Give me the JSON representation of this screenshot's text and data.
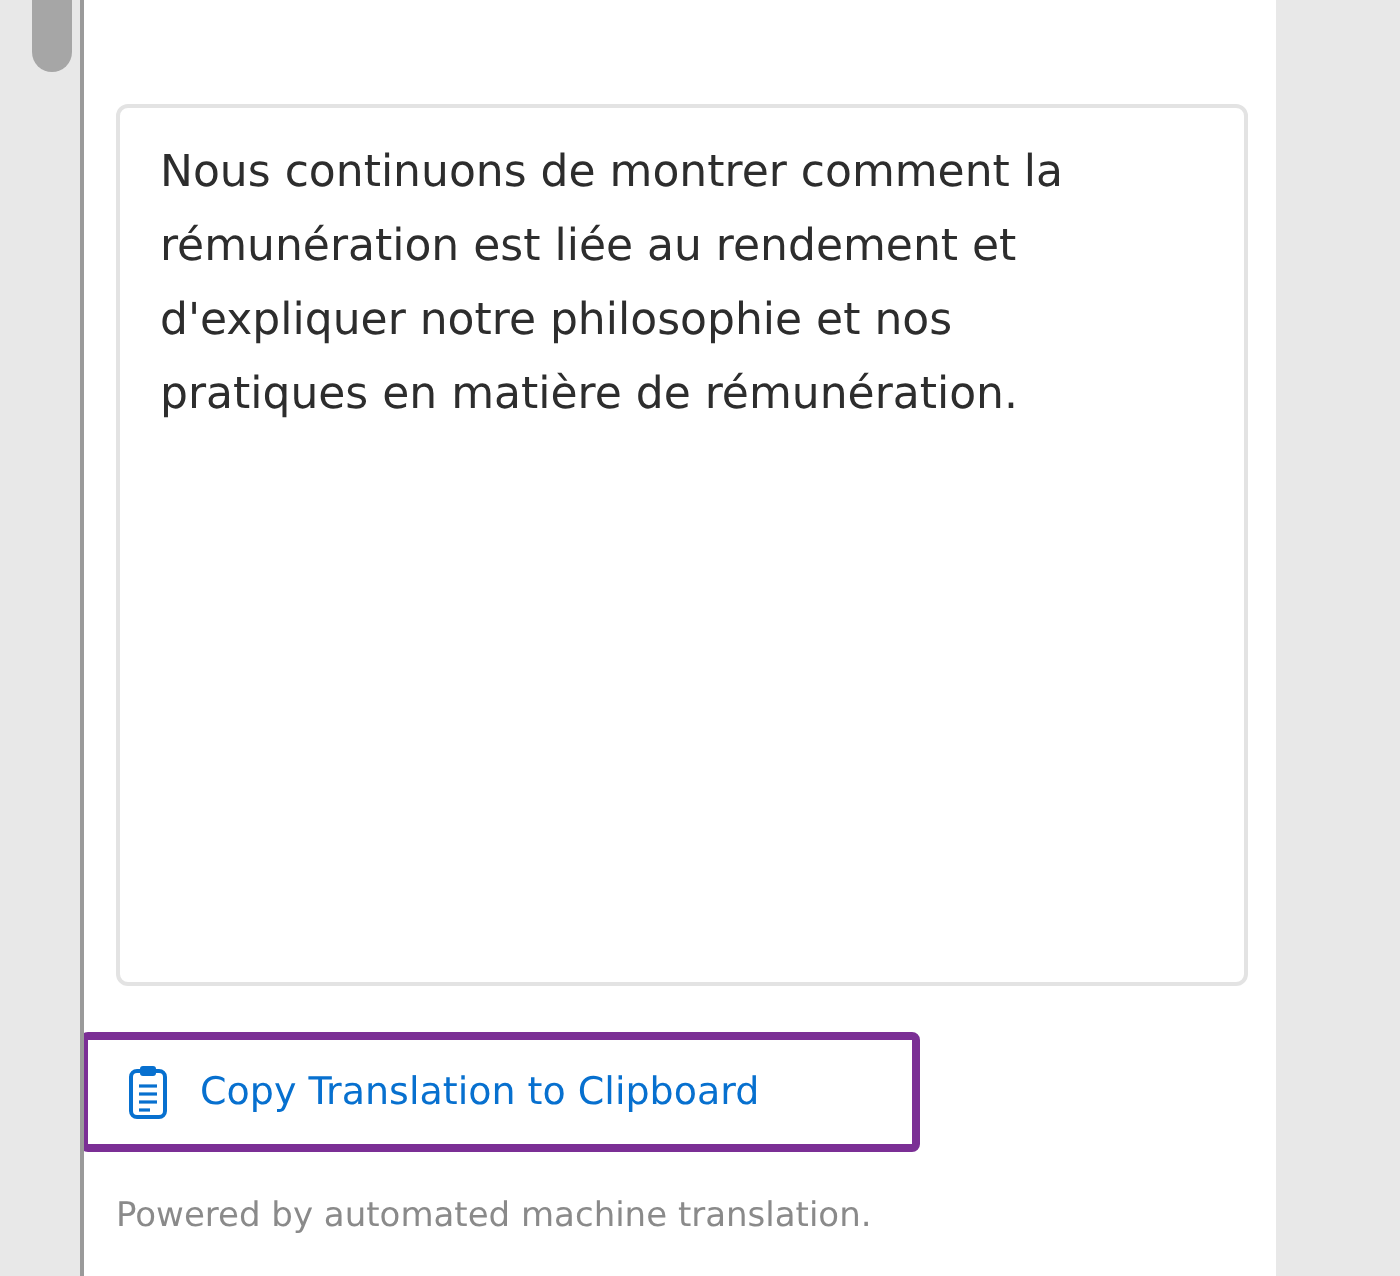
{
  "translation": {
    "text": "Nous continuons de montrer comment la rémunération est liée au rendement et d'expliquer notre philosophie et nos pratiques en matière de rémunération."
  },
  "copy_button": {
    "label": "Copy Translation to Clipboard",
    "focused": true
  },
  "footer": {
    "text": "Powered by automated machine translation."
  }
}
